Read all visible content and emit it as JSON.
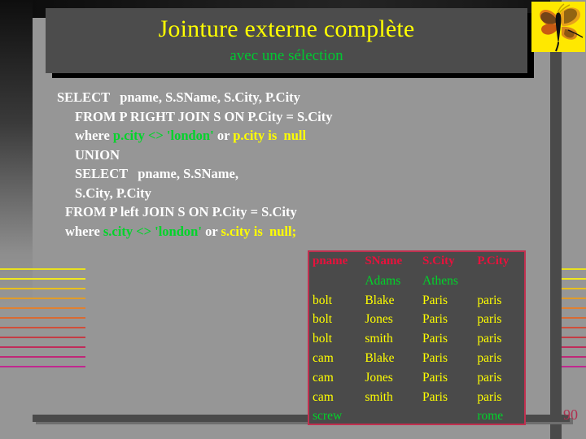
{
  "slide": {
    "title": "Jointure externe  complète",
    "subtitle": "avec une sélection",
    "page_number": "90",
    "colors": {
      "title": "#ffff00",
      "subtitle": "#00c832",
      "sql_text": "#ffffff",
      "sql_green": "#00d42a",
      "sql_yellow": "#ffff00",
      "table_header": "#e8113c",
      "table_border": "#c0304f",
      "table_bg": "#4a4a4a",
      "slide_bg": "#969696",
      "title_box": "#4c4c4c",
      "badge_bg": "#ffe800",
      "page_number": "#b03050"
    }
  },
  "badge": {
    "icon": "butterfly-icon"
  },
  "sql": {
    "lines": [
      {
        "indent": 0,
        "parts": [
          {
            "text": "SELECT   pname, S.SName, S.City, P.City",
            "color": "white"
          }
        ]
      },
      {
        "indent": 22,
        "parts": [
          {
            "text": "FROM P RIGHT JOIN S ON P.City = S.City",
            "color": "white"
          }
        ]
      },
      {
        "indent": 22,
        "parts": [
          {
            "text": "where ",
            "color": "white"
          },
          {
            "text": "p.city <> 'london'",
            "color": "green"
          },
          {
            "text": " or ",
            "color": "white"
          },
          {
            "text": "p.city is  null",
            "color": "yellow"
          }
        ]
      },
      {
        "indent": 22,
        "parts": [
          {
            "text": "UNION",
            "color": "white"
          }
        ]
      },
      {
        "indent": 22,
        "parts": [
          {
            "text": "SELECT   pname, S.SName,",
            "color": "white"
          }
        ]
      },
      {
        "indent": 22,
        "parts": [
          {
            "text": "S.City, P.City",
            "color": "white"
          }
        ]
      },
      {
        "indent": 10,
        "parts": [
          {
            "text": "FROM P left JOIN S ON P.City = S.City",
            "color": "white"
          }
        ]
      },
      {
        "indent": 10,
        "parts": [
          {
            "text": "where ",
            "color": "white"
          },
          {
            "text": "s.city <> 'london'",
            "color": "green"
          },
          {
            "text": " or ",
            "color": "white"
          },
          {
            "text": "s.city is  null;",
            "color": "yellow"
          }
        ]
      }
    ]
  },
  "result_table": {
    "headers": [
      "pname",
      "SName",
      "S.City",
      "P.City"
    ],
    "rows": [
      {
        "style": "green",
        "cells": [
          "",
          "Adams",
          "Athens",
          ""
        ]
      },
      {
        "style": "yellow",
        "cells": [
          "bolt",
          "Blake",
          "Paris",
          "paris"
        ]
      },
      {
        "style": "yellow",
        "cells": [
          "bolt",
          "Jones",
          "Paris",
          "paris"
        ]
      },
      {
        "style": "yellow",
        "cells": [
          "bolt",
          "smith",
          "Paris",
          "paris"
        ]
      },
      {
        "style": "yellow",
        "cells": [
          "cam",
          "Blake",
          "Paris",
          "paris"
        ]
      },
      {
        "style": "yellow",
        "cells": [
          "cam",
          "Jones",
          "Paris",
          "paris"
        ]
      },
      {
        "style": "yellow",
        "cells": [
          "cam",
          "smith",
          "Paris",
          "paris"
        ]
      },
      {
        "style": "green",
        "cells": [
          "screw",
          "",
          "",
          "rome"
        ]
      }
    ]
  },
  "decoration": {
    "rule_colors": [
      "#e8e020",
      "#efe81f",
      "#e8c01e",
      "#e09b2a",
      "#e08030",
      "#d96a33",
      "#d04e3a",
      "#c43c45",
      "#c02c5a",
      "#c02878",
      "#c02890"
    ]
  }
}
